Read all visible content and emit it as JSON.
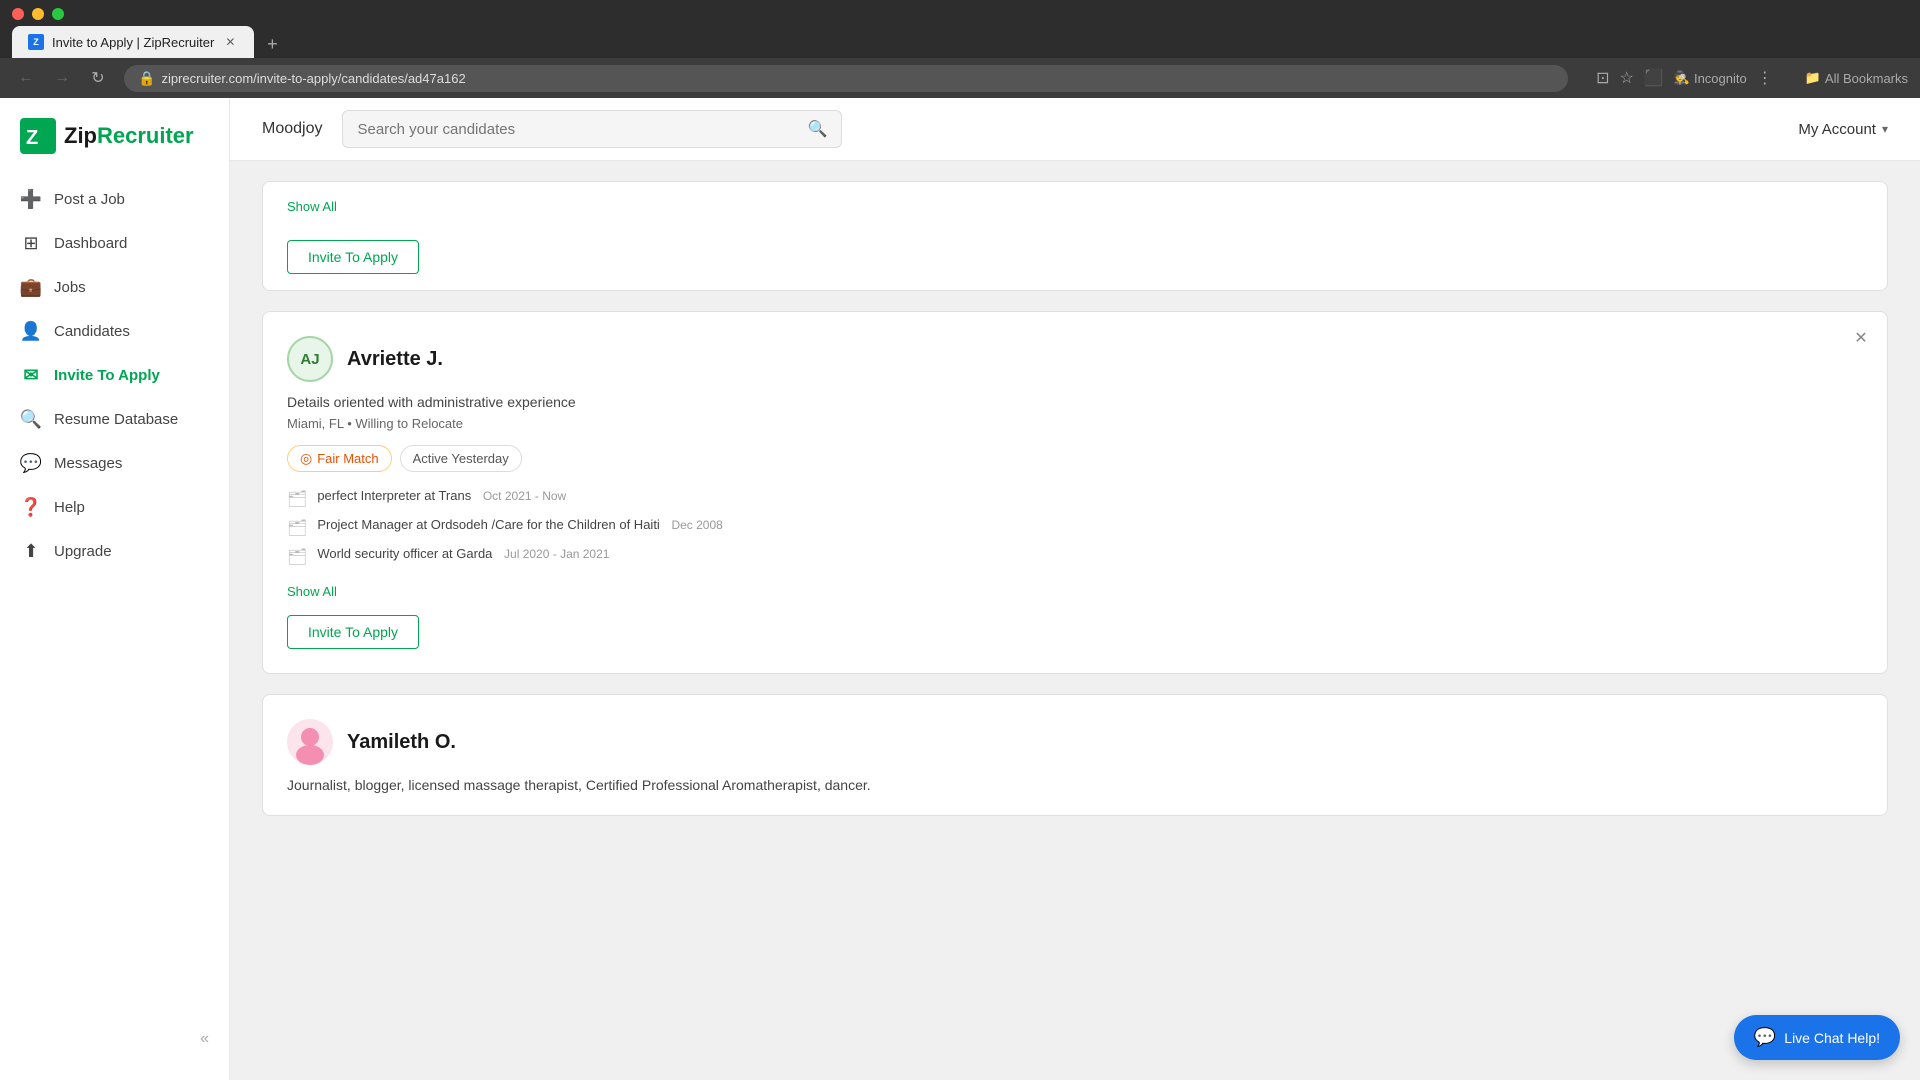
{
  "browser": {
    "tab_title": "Invite to Apply | ZipRecruiter",
    "tab_new_label": "+",
    "url": "ziprecruiter.com/invite-to-apply/candidates/ad47a162",
    "incognito_label": "Incognito",
    "bookmarks_label": "All Bookmarks"
  },
  "header": {
    "job_selector_label": "Moodjoy",
    "search_placeholder": "Search your candidates",
    "my_account_label": "My Account"
  },
  "sidebar": {
    "logo_text": "ZipRecruiter",
    "items": [
      {
        "id": "post-job",
        "label": "Post a Job",
        "icon": "➕"
      },
      {
        "id": "dashboard",
        "label": "Dashboard",
        "icon": "⊞"
      },
      {
        "id": "jobs",
        "label": "Jobs",
        "icon": "💼"
      },
      {
        "id": "candidates",
        "label": "Candidates",
        "icon": "👤"
      },
      {
        "id": "invite-to-apply",
        "label": "Invite To Apply",
        "icon": "✉"
      },
      {
        "id": "resume-database",
        "label": "Resume Database",
        "icon": "🔍"
      },
      {
        "id": "messages",
        "label": "Messages",
        "icon": "💬"
      },
      {
        "id": "help",
        "label": "Help",
        "icon": "❓"
      },
      {
        "id": "upgrade",
        "label": "Upgrade",
        "icon": "⬆"
      }
    ]
  },
  "partial_card": {
    "show_all_label": "Show All",
    "invite_btn_label": "Invite To Apply"
  },
  "candidate_avriette": {
    "initials": "AJ",
    "name": "Avriette J.",
    "tagline": "Details oriented with administrative experience",
    "location": "Miami, FL • Willing to Relocate",
    "tags": [
      {
        "id": "fair-match",
        "icon": "◎",
        "label": "Fair Match",
        "type": "fair-match"
      },
      {
        "id": "active-yesterday",
        "label": "Active Yesterday",
        "type": "active-yesterday"
      }
    ],
    "experience": [
      {
        "role": "perfect Interpreter at Trans",
        "date": "Oct 2021 - Now"
      },
      {
        "role": "Project Manager at Ordsodeh /Care for the Children of Haiti",
        "date": "Dec 2008"
      },
      {
        "role": "World security officer at Garda",
        "date": "Jul 2020 - Jan 2021"
      }
    ],
    "show_all_label": "Show All",
    "invite_btn_label": "Invite To Apply"
  },
  "candidate_yamileth": {
    "name": "Yamileth O.",
    "tagline": "Journalist, blogger, licensed massage therapist, Certified Professional Aromatherapist, dancer."
  },
  "live_chat": {
    "label": "Live Chat Help!"
  }
}
